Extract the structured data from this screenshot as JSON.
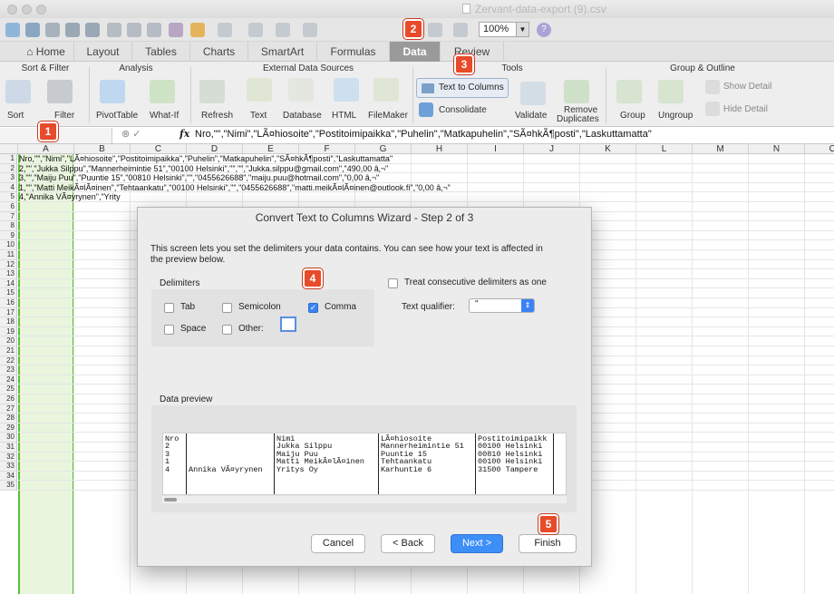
{
  "window": {
    "title": "Zervant-data-export (9).csv"
  },
  "toolbar": {
    "zoom": "100%",
    "help": "?"
  },
  "tabs": [
    "Home",
    "Layout",
    "Tables",
    "Charts",
    "SmartArt",
    "Formulas",
    "Data",
    "Review"
  ],
  "ribbon": {
    "groups": [
      "Sort & Filter",
      "Analysis",
      "External Data Sources",
      "Tools",
      "Group & Outline"
    ],
    "buttons": {
      "sort": "Sort",
      "filter": "Filter",
      "pivot": "PivotTable",
      "whatif": "What-If",
      "refresh": "Refresh",
      "text": "Text",
      "database": "Database",
      "html": "HTML",
      "filemaker": "FileMaker",
      "text_to_columns": "Text to Columns",
      "consolidate": "Consolidate",
      "validate": "Validate",
      "remove_dup_1": "Remove",
      "remove_dup_2": "Duplicates",
      "group": "Group",
      "ungroup": "Ungroup",
      "show_detail": "Show Detail",
      "hide_detail": "Hide Detail"
    }
  },
  "formula_bar": {
    "fx": "fx",
    "content": "Nro,\"\",\"Nimi\",\"LÃ¤hiosoite\",\"Postitoimipaikka\",\"Puhelin\",\"Matkapuhelin\",\"SÃ¤hkÃ¶posti\",\"Laskuttamatta\""
  },
  "sheet": {
    "columns": [
      "A",
      "B",
      "C",
      "D",
      "E",
      "F",
      "G",
      "H",
      "I",
      "J",
      "K",
      "L",
      "M",
      "N",
      "O"
    ],
    "rows": [
      "1",
      "2",
      "3",
      "4",
      "5",
      "6",
      "7",
      "8",
      "9",
      "10",
      "11",
      "12",
      "13",
      "14",
      "15",
      "16",
      "17",
      "18",
      "19",
      "20",
      "21",
      "22",
      "23",
      "24",
      "25",
      "26",
      "27",
      "28",
      "29",
      "30",
      "31",
      "32",
      "33",
      "34",
      "35"
    ],
    "cells": [
      "Nro,\"\",\"Nimi\",\"LÃ¤hiosoite\",\"Postitoimipaikka\",\"Puhelin\",\"Matkapuhelin\",\"SÃ¤hkÃ¶posti\",\"Laskuttamatta\"",
      "2,\"\",\"Jukka Silppu\",\"Mannerheimintie 51\",\"00100 Helsinki\",\"\",\"\",\"Jukka.silppu@gmail.com\",\"490,00 â‚¬\"",
      "3,\"\",\"Maiju Puu\",\"Puuntie 15\",\"00810 Helsinki\",\"\",\"0455626688\",\"maiju.puu@hotmail.com\",\"0,00 â‚¬\"",
      "1,\"\",\"Matti MeikÃ¤lÃ¤inen\",\"Tehtaankatu\",\"00100 Helsinki\",\"\",\"0455626688\",\"matti.meikÃ¤lÃ¤inen@outlook.fi\",\"0,00 â‚¬\"",
      "4,\"Annika VÃ¤yrynen\",\"Yrity"
    ]
  },
  "dialog": {
    "title": "Convert Text to Columns Wizard - Step 2 of 3",
    "description": "This screen lets you set the delimiters your data contains.  You can see how your text is affected in the preview below.",
    "delimiters_label": "Delimiters",
    "tab": "Tab",
    "semicolon": "Semicolon",
    "comma": "Comma",
    "space": "Space",
    "other": "Other:",
    "consecutive": "Treat consecutive delimiters as one",
    "qualifier_label": "Text qualifier:",
    "qualifier_value": "\"",
    "preview_label": "Data preview",
    "preview_cols": [
      "Nro\n2\n3\n1\n4",
      "\n\n\n\nAnnika VÃ¤yrynen",
      "Nimi\nJukka Silppu\nMaiju Puu\nMatti MeikÃ¤lÃ¤inen\nYritys Oy",
      "LÃ¤hiosoite\nMannerheimintie 51\nPuuntie 15\nTehtaankatu\nKarhuntie 6",
      "Postitoimipaikk\n00100 Helsinki\n00810 Helsinki\n00100 Helsinki\n31500 Tampere"
    ],
    "buttons": {
      "cancel": "Cancel",
      "back": "< Back",
      "next": "Next >",
      "finish": "Finish"
    }
  },
  "markers": [
    "1",
    "2",
    "3",
    "4",
    "5"
  ],
  "colors": {
    "accent": "#3d8ef6",
    "marker": "#e84a2a",
    "selection": "#5bbd3f"
  }
}
